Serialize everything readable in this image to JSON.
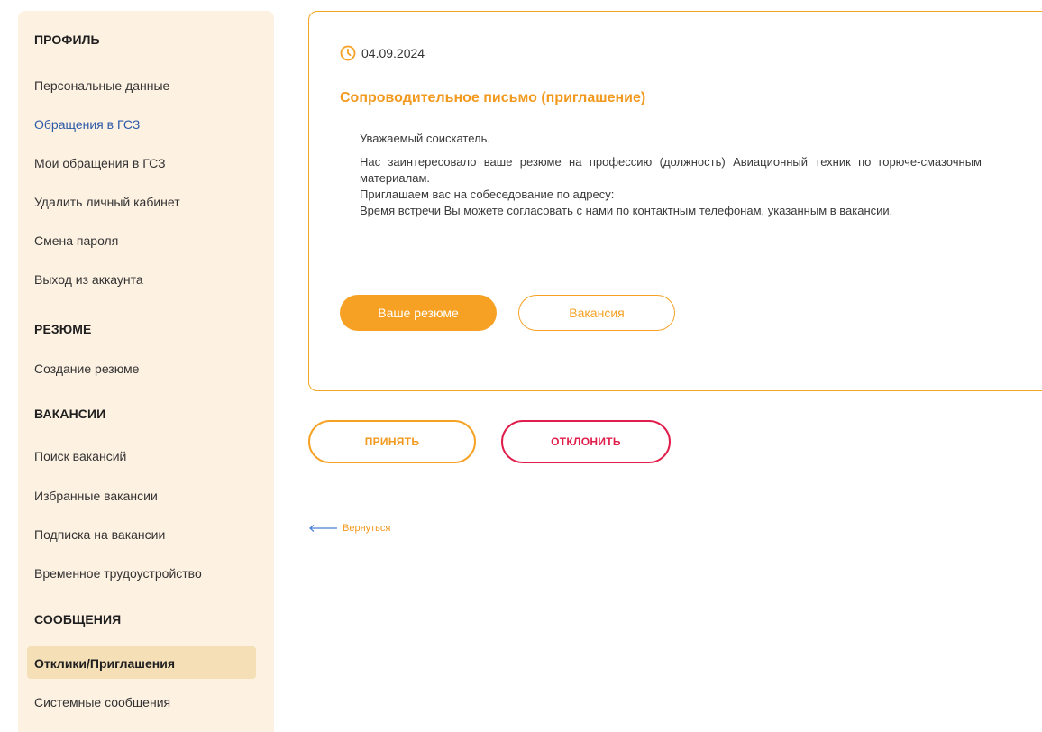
{
  "sidebar": {
    "profile_title": "ПРОФИЛЬ",
    "profile_items": [
      "Персональные данные",
      "Обращения в ГСЗ",
      "Мои обращения в ГСЗ",
      "Удалить личный кабинет",
      "Смена пароля",
      "Выход из аккаунта"
    ],
    "resume_title": "РЕЗЮМЕ",
    "resume_items": [
      "Создание резюме"
    ],
    "vacancies_title": "ВАКАНСИИ",
    "vacancies_items": [
      "Поиск вакансий",
      "Избранные вакансии",
      "Подписка на вакансии",
      "Временное трудоустройство"
    ],
    "messages_title": "СООБЩЕНИЯ",
    "messages_items": [
      "Отклики/Приглашения",
      "Системные сообщения"
    ]
  },
  "card": {
    "date": "04.09.2024",
    "title": "Сопроводительное письмо (приглашение)",
    "greeting": "Уважаемый соискатель.",
    "body_1": "Нас заинтересовало ваше резюме на профессию (должность) Авиационный техник по горюче-смазочным материалам.",
    "body_2": "Приглашаем вас на собеседование по адресу:",
    "body_3": "Время встречи Вы можете согласовать с нами по контактным телефонам, указанным в вакансии.",
    "resume_button": "Ваше резюме",
    "vacancy_button": "Вакансия"
  },
  "actions": {
    "accept": "ПРИНЯТЬ",
    "decline": "ОТКЛОНИТЬ",
    "back": "Вернуться"
  },
  "colors": {
    "accent": "#f6a123",
    "decline": "#e01e4b",
    "sidebar_bg": "#fdf1e2",
    "sidebar_active_bg": "#f5dfb7",
    "link": "#2b5aa8"
  },
  "icons": {
    "date": "clock-icon",
    "back": "arrow-left-icon"
  }
}
